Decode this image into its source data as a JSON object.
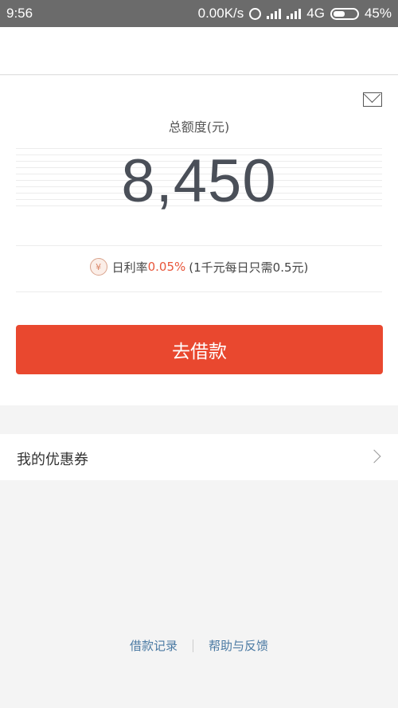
{
  "status_bar": {
    "time": "9:56",
    "net_speed": "0.00K/s",
    "network": "4G",
    "battery": "45%"
  },
  "main": {
    "total_label": "总额度(元)",
    "amount": "8,450",
    "rate": {
      "prefix": "日利率",
      "value": "0.05%",
      "note": "(1千元每日只需0.5元)"
    },
    "borrow_button": "去借款"
  },
  "coupons": {
    "label": "我的优惠券"
  },
  "footer": {
    "records": "借款记录",
    "help": "帮助与反馈"
  },
  "colors": {
    "accent": "#e9482f",
    "rate_highlight": "#e8553a",
    "link": "#4b7aa3"
  },
  "icons": {
    "status": [
      "alarm-icon",
      "signal-icon",
      "battery-icon"
    ],
    "card": [
      "mail-icon",
      "yuan-icon"
    ],
    "coupon": "chevron-right-icon"
  }
}
